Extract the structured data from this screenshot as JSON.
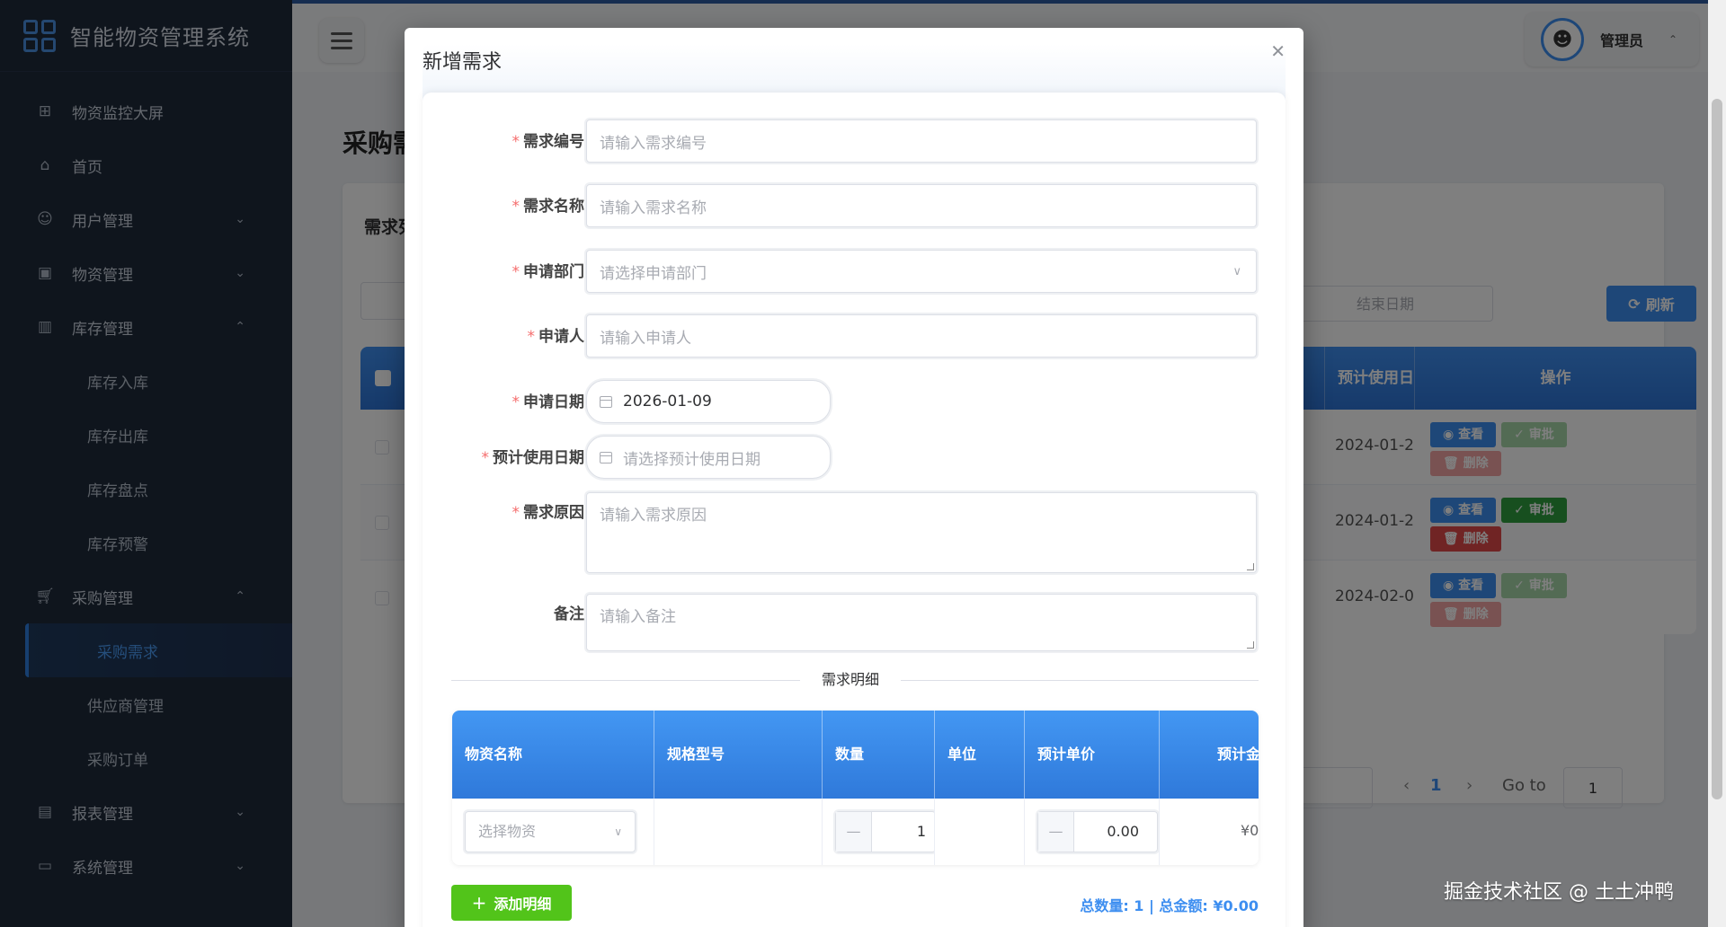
{
  "app": {
    "title": "智能物资管理系统"
  },
  "sidebar": {
    "items": [
      {
        "label": "物资监控大屏",
        "icon": "grid-icon",
        "expand": ""
      },
      {
        "label": "首页",
        "icon": "home-icon",
        "expand": ""
      },
      {
        "label": "用户管理",
        "icon": "users-icon",
        "expand": "⌄"
      },
      {
        "label": "物资管理",
        "icon": "box-icon",
        "expand": "⌄"
      },
      {
        "label": "库存管理",
        "icon": "book-icon",
        "expand": "⌃"
      }
    ],
    "inventory_children": [
      "库存入库",
      "库存出库",
      "库存盘点",
      "库存预警"
    ],
    "purchase": {
      "label": "采购管理",
      "icon": "cart-icon",
      "expand": "⌃"
    },
    "purchase_children": {
      "active": "采购需求",
      "others": [
        "供应商管理",
        "采购订单"
      ]
    },
    "bottom_items": [
      {
        "label": "报表管理",
        "icon": "chart-icon",
        "expand": "⌄"
      },
      {
        "label": "系统管理",
        "icon": "monitor-icon",
        "expand": "⌄"
      }
    ]
  },
  "header": {
    "user_name": "管理员"
  },
  "page": {
    "title": "采购需",
    "card_title": "需求列",
    "end_date_placeholder": "结束日期",
    "refresh_label": "刷新",
    "columns": {
      "expected_date": "预计使用日",
      "operations": "操作"
    },
    "rows": [
      {
        "date": "2024-01-2",
        "approve_enabled": false
      },
      {
        "date": "2024-01-2",
        "approve_enabled": true
      },
      {
        "date": "2024-02-0",
        "approve_enabled": false
      }
    ],
    "buttons": {
      "view": "查看",
      "approve": "审批",
      "delete": "删除"
    },
    "pager": {
      "current_page": "1",
      "goto_label": "Go to",
      "goto_value": "1"
    }
  },
  "dialog": {
    "title": "新增需求",
    "fields": {
      "demand_no": {
        "label": "需求编号",
        "placeholder": "请输入需求编号"
      },
      "demand_name": {
        "label": "需求名称",
        "placeholder": "请输入需求名称"
      },
      "department": {
        "label": "申请部门",
        "placeholder": "请选择申请部门"
      },
      "applicant": {
        "label": "申请人",
        "placeholder": "请输入申请人"
      },
      "apply_date": {
        "label": "申请日期",
        "value": "2026-01-09"
      },
      "expected_date": {
        "label": "预计使用日期",
        "placeholder": "请选择预计使用日期"
      },
      "reason": {
        "label": "需求原因",
        "placeholder": "请输入需求原因"
      },
      "remark": {
        "label": "备注",
        "placeholder": "请输入备注"
      }
    },
    "detail_section": "需求明细",
    "detail_table": {
      "columns": [
        "物资名称",
        "规格型号",
        "数量",
        "单位",
        "预计单价",
        "预计金"
      ],
      "row": {
        "material_placeholder": "选择物资",
        "quantity": "1",
        "unit_price": "0.00",
        "amount": "¥0"
      }
    },
    "add_detail_label": "添加明细",
    "totals": "总数量: 1 | 总金额: ¥0.00"
  },
  "watermark": "掘金技术社区 @ 土土冲鸭"
}
